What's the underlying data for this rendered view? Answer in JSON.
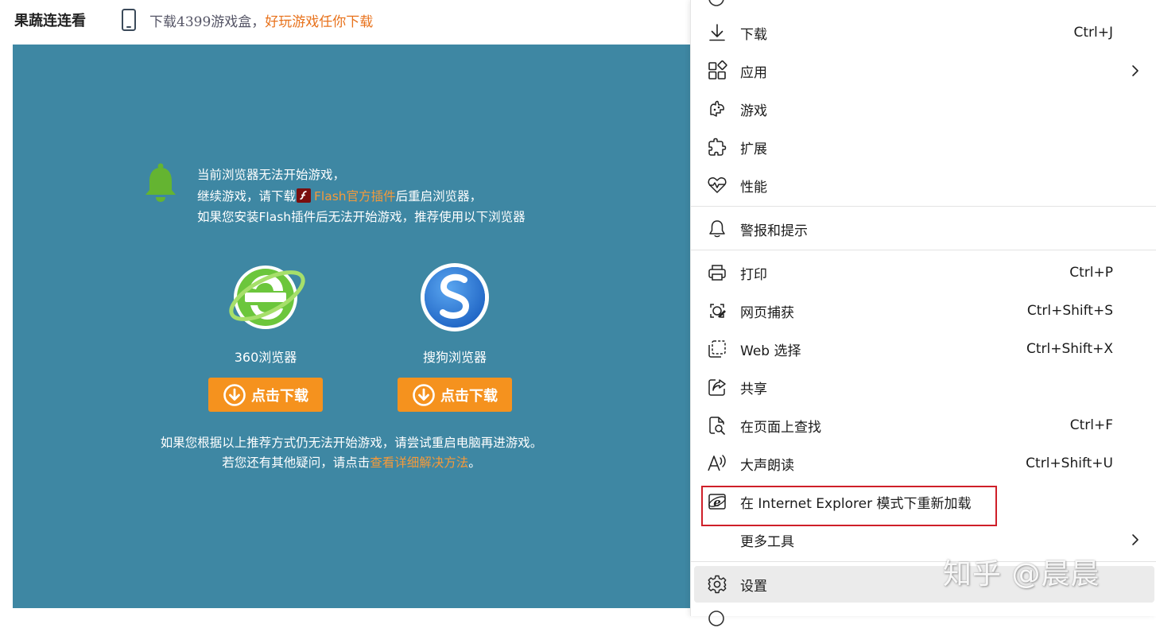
{
  "header": {
    "game_title": "果蔬连连看",
    "promo_part1": "下载4399游戏盒，",
    "promo_part2": "好玩游戏任你下载"
  },
  "notice": {
    "line1": "当前浏览器无法开始游戏，",
    "line2_prefix": "继续游戏，请下载",
    "line2_link": "Flash官方插件",
    "line2_suffix": "后重启浏览器，",
    "line3": "如果您安装Flash插件后无法开始游戏，推荐使用以下浏览器"
  },
  "browsers": [
    {
      "name": "360浏览器",
      "button": "点击下载",
      "icon": "ie-360-logo-icon"
    },
    {
      "name": "搜狗浏览器",
      "button": "点击下载",
      "icon": "sogou-logo-icon"
    }
  ],
  "tip": {
    "line1": "如果您根据以上推荐方式仍无法开始游戏，请尝试重启电脑再进游戏。",
    "line2_prefix": "若您还有其他疑问，请点击",
    "line2_link": "查看详细解决方法",
    "line2_suffix": "。"
  },
  "menu": {
    "items": [
      {
        "label": "下载",
        "shortcut": "Ctrl+J",
        "icon": "download-icon"
      },
      {
        "label": "应用",
        "shortcut": "",
        "icon": "apps-icon",
        "submenu": true
      },
      {
        "label": "游戏",
        "shortcut": "",
        "icon": "games-icon"
      },
      {
        "label": "扩展",
        "shortcut": "",
        "icon": "extensions-icon"
      },
      {
        "label": "性能",
        "shortcut": "",
        "icon": "performance-icon"
      },
      {
        "label": "警报和提示",
        "shortcut": "",
        "icon": "bell-icon"
      },
      {
        "label": "打印",
        "shortcut": "Ctrl+P",
        "icon": "print-icon"
      },
      {
        "label": "网页捕获",
        "shortcut": "Ctrl+Shift+S",
        "icon": "screenshot-icon"
      },
      {
        "label": "Web 选择",
        "shortcut": "Ctrl+Shift+X",
        "icon": "web-select-icon"
      },
      {
        "label": "共享",
        "shortcut": "",
        "icon": "share-icon"
      },
      {
        "label": "在页面上查找",
        "shortcut": "Ctrl+F",
        "icon": "find-icon"
      },
      {
        "label": "大声朗读",
        "shortcut": "Ctrl+Shift+U",
        "icon": "read-aloud-icon"
      },
      {
        "label": "在 Internet Explorer 模式下重新加载",
        "shortcut": "",
        "icon": "ie-mode-icon"
      },
      {
        "label": "更多工具",
        "shortcut": "",
        "icon": "",
        "submenu": true
      },
      {
        "label": "设置",
        "shortcut": "",
        "icon": "settings-icon"
      }
    ]
  },
  "watermark": "知乎 @晨晨",
  "colors": {
    "game_bg": "#3e87a3",
    "accent_orange": "#f5921e",
    "link_orange": "#f59a3a",
    "highlight_red": "#cf1f29"
  }
}
